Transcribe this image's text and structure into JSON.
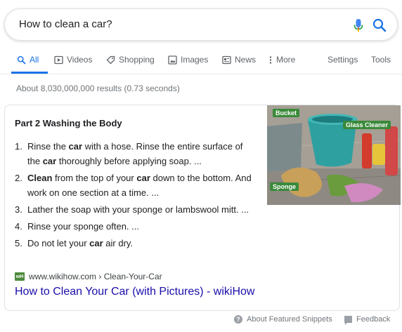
{
  "search": {
    "query": "How to clean a car?",
    "mic_icon": "microphone-icon",
    "search_icon": "search-icon",
    "colors": {
      "mic_blue": "#4285f4",
      "mic_red": "#ea4335",
      "search_blue": "#1a73e8"
    }
  },
  "tabs": {
    "items": [
      {
        "label": "All",
        "icon": "search-icon",
        "active": true
      },
      {
        "label": "Videos",
        "icon": "video-icon"
      },
      {
        "label": "Shopping",
        "icon": "tag-icon"
      },
      {
        "label": "Images",
        "icon": "image-icon"
      },
      {
        "label": "News",
        "icon": "news-icon"
      },
      {
        "label": "More",
        "icon": "more-vertical-icon"
      }
    ],
    "settings_label": "Settings",
    "tools_label": "Tools",
    "active_color": "#1a73e8"
  },
  "result_stats": "About 8,030,000,000 results (0.73 seconds)",
  "featured_snippet": {
    "title": "Part 2 Washing the Body",
    "steps": [
      {
        "number": "1.",
        "parts": [
          "Rinse the ",
          "car",
          " with a hose. Rinse the entire surface of the ",
          "car",
          " thoroughly before applying soap. ..."
        ]
      },
      {
        "number": "2.",
        "parts": [
          "",
          "Clean",
          " from the top of your ",
          "car",
          " down to the bottom. And work on one section at a time. ..."
        ]
      },
      {
        "number": "3.",
        "parts": [
          "Lather the soap with your sponge or lambswool mitt. ..."
        ]
      },
      {
        "number": "4.",
        "parts": [
          "Rinse your sponge often. ..."
        ]
      },
      {
        "number": "5.",
        "parts": [
          "Do not let your ",
          "car",
          " air dry."
        ]
      }
    ],
    "image": {
      "labels": [
        "Bucket",
        "Glass Cleaner",
        "Sponge"
      ]
    },
    "source": {
      "favicon_text": "wH",
      "url": "www.wikihow.com › Clean-Your-Car",
      "title": "How to Clean Your Car (with Pictures) - wikiHow"
    }
  },
  "footer": {
    "about_label": "About Featured Snippets",
    "feedback_label": "Feedback"
  }
}
